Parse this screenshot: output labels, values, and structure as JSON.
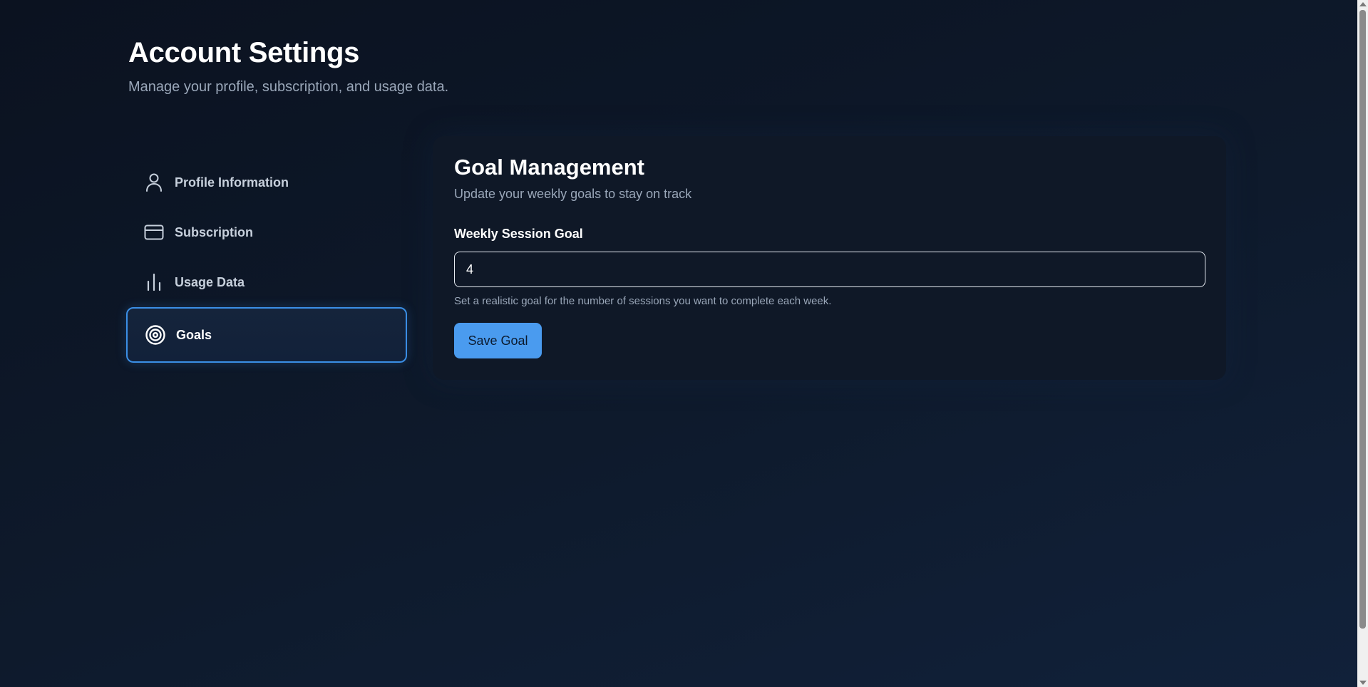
{
  "header": {
    "title": "Account Settings",
    "subtitle": "Manage your profile, subscription, and usage data."
  },
  "sidebar": {
    "items": [
      {
        "label": "Profile Information",
        "icon": "user-icon",
        "active": false
      },
      {
        "label": "Subscription",
        "icon": "credit-card-icon",
        "active": false
      },
      {
        "label": "Usage Data",
        "icon": "bar-chart-icon",
        "active": false
      },
      {
        "label": "Goals",
        "icon": "target-icon",
        "active": true
      }
    ]
  },
  "goal_card": {
    "title": "Goal Management",
    "subtitle": "Update your weekly goals to stay on track",
    "field_label": "Weekly Session Goal",
    "field_value": "4",
    "help_text": "Set a realistic goal for the number of sessions you want to complete each week.",
    "save_label": "Save Goal"
  },
  "colors": {
    "accent": "#4a9bef",
    "active_border": "#3b8fe6",
    "background": "#0b1220",
    "card": "#0f1827",
    "muted_text": "#9aa7b9"
  }
}
